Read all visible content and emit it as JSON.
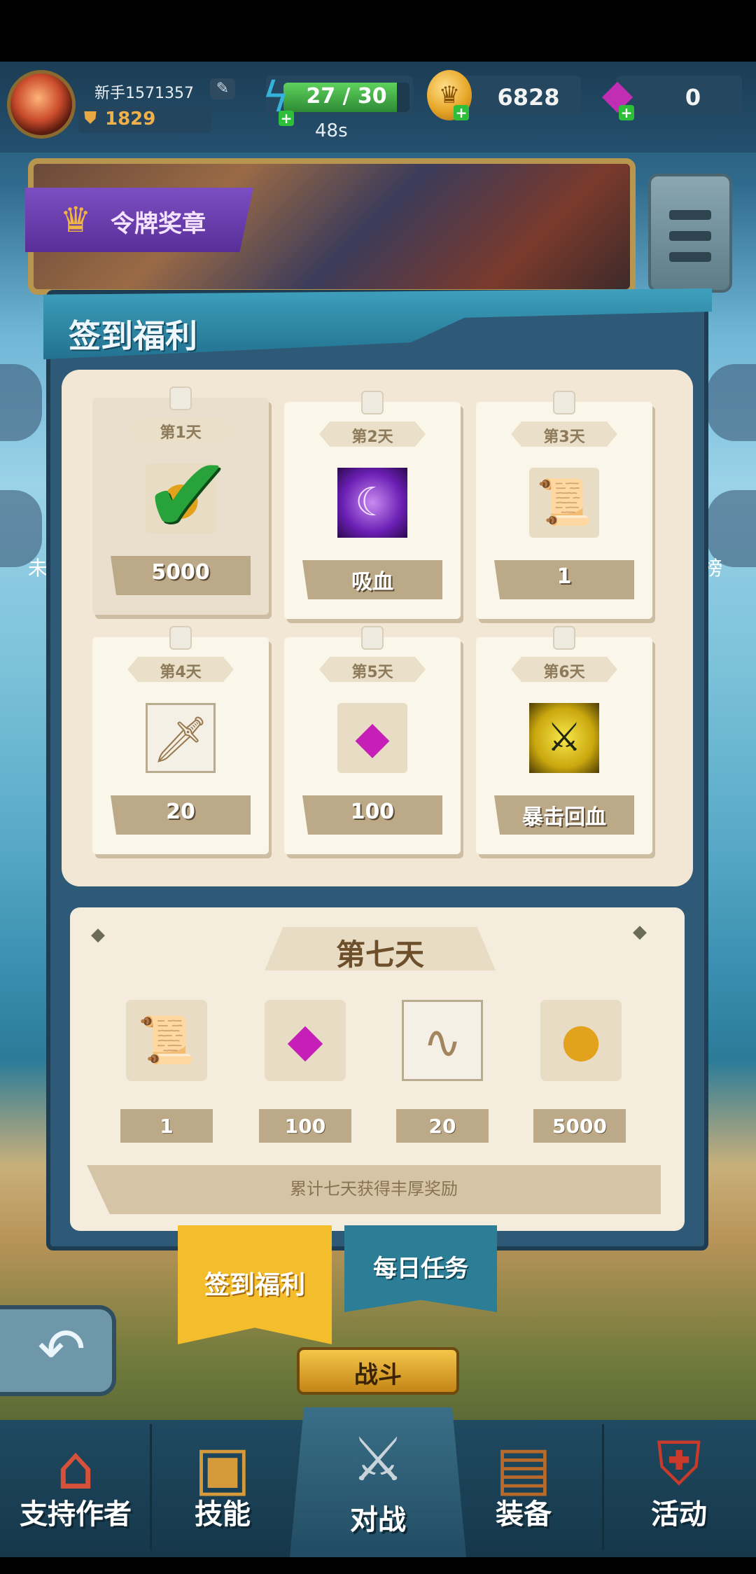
{
  "player": {
    "name": "新手1571357",
    "rank": "1829",
    "edit_icon": "pencil-icon"
  },
  "resources": {
    "energy": {
      "text": "27 / 30",
      "current": 27,
      "max": 30,
      "timer": "48s",
      "icon": "lightning-icon"
    },
    "coins": {
      "value": "6828",
      "icon": "coin-icon"
    },
    "gems": {
      "value": "0",
      "icon": "gem-icon"
    }
  },
  "banner": {
    "label": "令牌奖章"
  },
  "side": {
    "left_label": "未",
    "right_label": "榜"
  },
  "panel": {
    "title": "签到福利"
  },
  "daily_rewards": [
    {
      "day": "第1天",
      "amount": "5000",
      "icon": "coin-icon",
      "claimed": true
    },
    {
      "day": "第2天",
      "amount": "吸血",
      "icon": "vampire-skill-icon",
      "claimed": false
    },
    {
      "day": "第3天",
      "amount": "1",
      "icon": "scroll-icon",
      "claimed": false
    },
    {
      "day": "第4天",
      "amount": "20",
      "icon": "sword-scroll-icon",
      "claimed": false
    },
    {
      "day": "第5天",
      "amount": "100",
      "icon": "gem-icon",
      "claimed": false
    },
    {
      "day": "第6天",
      "amount": "暴击回血",
      "icon": "crit-heal-skill-icon",
      "claimed": false
    }
  ],
  "day7": {
    "title": "第七天",
    "items": [
      {
        "amount": "1",
        "icon": "scroll-icon"
      },
      {
        "amount": "100",
        "icon": "gem-icon"
      },
      {
        "amount": "20",
        "icon": "pet-scroll-icon"
      },
      {
        "amount": "5000",
        "icon": "coin-icon"
      }
    ],
    "footer": "累计七天获得丰厚奖励"
  },
  "tabs": {
    "signin": "签到福利",
    "daily_tasks": "每日任务"
  },
  "battle_button": "战斗",
  "bottom_nav": [
    {
      "label": "支持作者",
      "icon": "shop-icon"
    },
    {
      "label": "技能",
      "icon": "skill-book-icon"
    },
    {
      "label": "对战",
      "icon": "crossed-swords-icon"
    },
    {
      "label": "装备",
      "icon": "backpack-icon"
    },
    {
      "label": "活动",
      "icon": "shield-badge-icon"
    }
  ],
  "colors": {
    "accent_gold": "#f4bd2c",
    "panel_blue": "#2e5a77",
    "paper": "#f1e7d4",
    "check_green": "#28a23a"
  }
}
